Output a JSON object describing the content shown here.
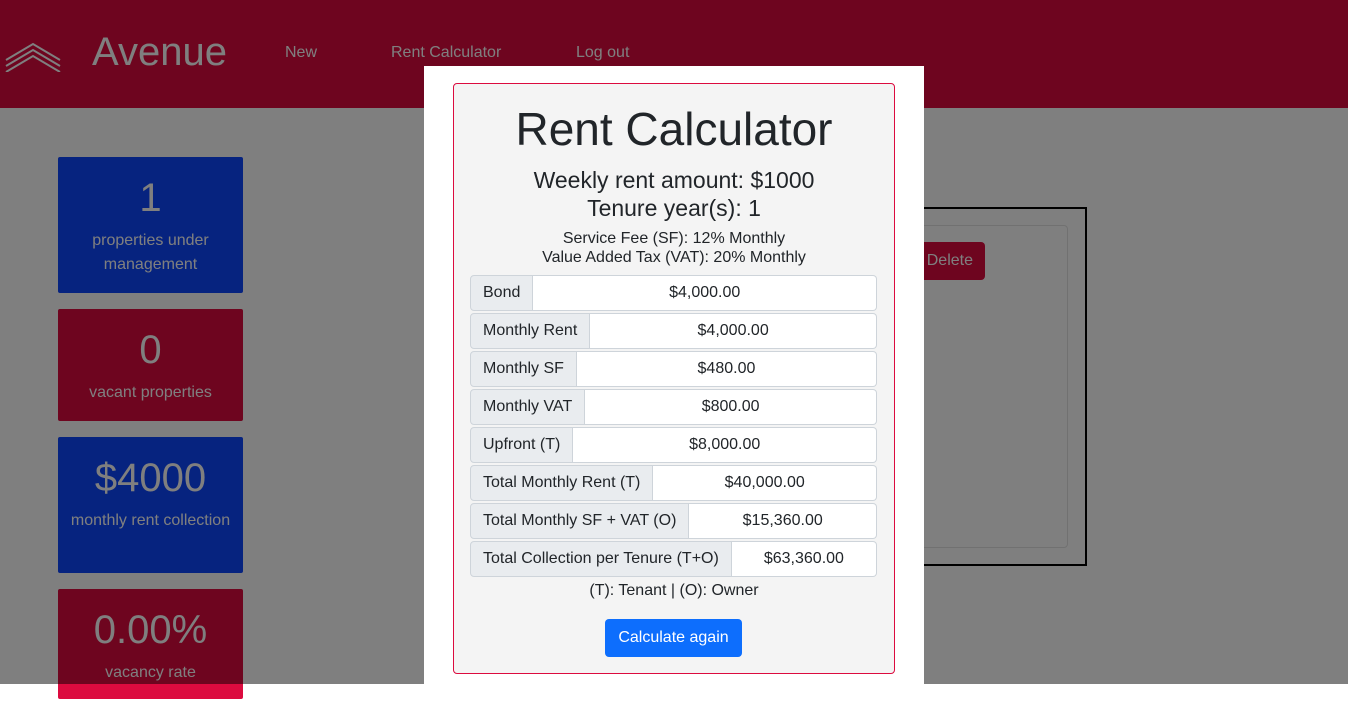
{
  "header": {
    "brand": "Avenue",
    "nav": {
      "new": "New",
      "rent_calculator": "Rent Calculator",
      "logout": "Log out"
    },
    "color": "#dc0b3f"
  },
  "stats": [
    {
      "value": "1",
      "label": "properties under management",
      "color": "#0d47ff"
    },
    {
      "value": "0",
      "label": "vacant properties",
      "color": "#dc0b3f"
    },
    {
      "value": "$4000",
      "label": "monthly rent collection",
      "color": "#0d47ff"
    },
    {
      "value": "0.00%",
      "label": "vacancy rate",
      "color": "#dc0b3f"
    }
  ],
  "property": {
    "delete_label": "Delete"
  },
  "calculator": {
    "title": "Rent Calculator",
    "weekly": "Weekly rent amount: $1000",
    "tenure": "Tenure year(s): 1",
    "service_fee": "Service Fee (SF): 12% Monthly",
    "vat": "Value Added Tax (VAT): 20% Monthly",
    "rows": [
      {
        "label": "Bond",
        "value": "$4,000.00"
      },
      {
        "label": "Monthly Rent",
        "value": "$4,000.00"
      },
      {
        "label": "Monthly SF",
        "value": "$480.00"
      },
      {
        "label": "Monthly VAT",
        "value": "$800.00"
      },
      {
        "label": "Upfront (T)",
        "value": "$8,000.00"
      },
      {
        "label": "Total Monthly Rent (T)",
        "value": "$40,000.00"
      },
      {
        "label": "Total Monthly SF + VAT (O)",
        "value": "$15,360.00"
      },
      {
        "label": "Total Collection per Tenure (T+O)",
        "value": "$63,360.00"
      }
    ],
    "legend": "(T): Tenant | (O): Owner",
    "button": "Calculate again",
    "button_color": "#0d6efd"
  }
}
